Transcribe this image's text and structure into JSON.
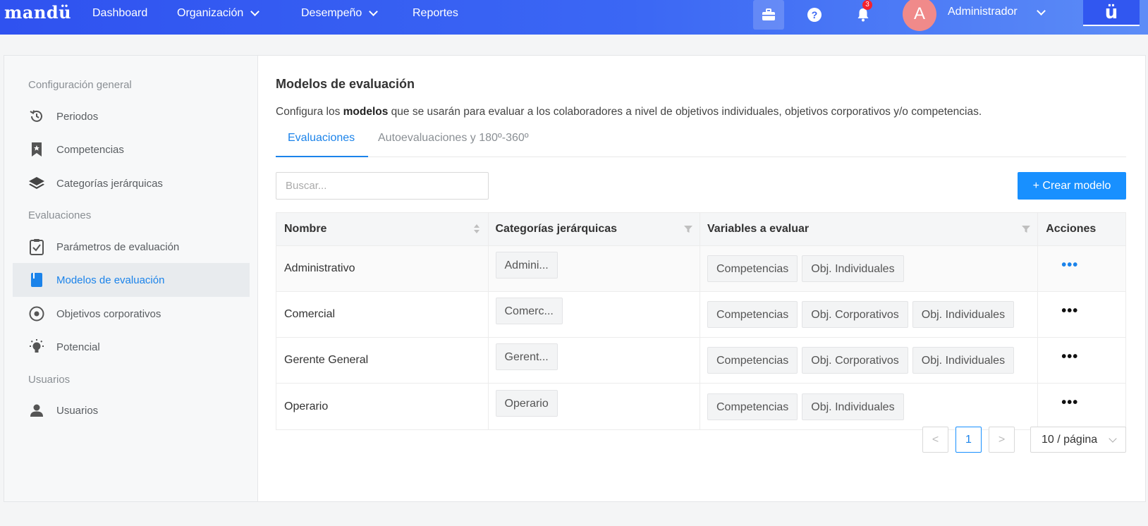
{
  "topbar": {
    "logo": "mandü",
    "nav": [
      {
        "label": "Dashboard",
        "has_dropdown": false
      },
      {
        "label": "Organización",
        "has_dropdown": true
      },
      {
        "label": "Desempeño",
        "has_dropdown": true
      },
      {
        "label": "Reportes",
        "has_dropdown": false
      }
    ],
    "notification_count": "3",
    "user_initial": "A",
    "user_name": "Administrador",
    "brand_mark": "ü"
  },
  "sidebar": {
    "group_general": "Configuración general",
    "group_evaluaciones": "Evaluaciones",
    "group_usuarios": "Usuarios",
    "items": [
      {
        "label": "Periodos",
        "icon": "history-icon"
      },
      {
        "label": "Competencias",
        "icon": "bookmark-star-icon"
      },
      {
        "label": "Categorías jerárquicas",
        "icon": "layers-icon"
      },
      {
        "label": "Parámetros de evaluación",
        "icon": "clipboard-check-icon"
      },
      {
        "label": "Modelos de evaluación",
        "icon": "book-icon",
        "active": true
      },
      {
        "label": "Objetivos corporativos",
        "icon": "target-icon"
      },
      {
        "label": "Potencial",
        "icon": "lightbulb-icon"
      },
      {
        "label": "Usuarios",
        "icon": "user-icon"
      }
    ]
  },
  "main": {
    "title": "Modelos de evaluación",
    "description_prefix": "Configura los ",
    "description_bold": "modelos",
    "description_suffix": " que se usarán para evaluar a los colaboradores a nivel de objetivos individuales, objetivos corporativos y/o competencias.",
    "tabs": [
      {
        "label": "Evaluaciones",
        "active": true
      },
      {
        "label": "Autoevaluaciones y 180º-360º",
        "active": false
      }
    ],
    "search_placeholder": "Buscar...",
    "create_button": "+ Crear modelo"
  },
  "table": {
    "columns": [
      "Nombre",
      "Categorías jerárquicas",
      "Variables a evaluar",
      "Acciones"
    ],
    "rows": [
      {
        "nombre": "Administrativo",
        "categoria": "Admini...",
        "variables": [
          "Competencias",
          "Obj. Individuales"
        ],
        "acciones": "•••"
      },
      {
        "nombre": "Comercial",
        "categoria": "Comerc...",
        "variables": [
          "Competencias",
          "Obj. Corporativos",
          "Obj. Individuales"
        ],
        "acciones": "•••"
      },
      {
        "nombre": "Gerente General",
        "categoria": "Gerent...",
        "variables": [
          "Competencias",
          "Obj. Corporativos",
          "Obj. Individuales"
        ],
        "acciones": "•••"
      },
      {
        "nombre": "Operario",
        "categoria": "Operario",
        "variables": [
          "Competencias",
          "Obj. Individuales"
        ],
        "acciones": "•••"
      }
    ]
  },
  "pagination": {
    "prev": "<",
    "current_page": "1",
    "next": ">",
    "page_size": "10 / página"
  },
  "colors": {
    "accent": "#1890ff",
    "topbar_start": "#2f52f0",
    "topbar_end": "#5c8cf7",
    "badge": "#f5222d"
  }
}
